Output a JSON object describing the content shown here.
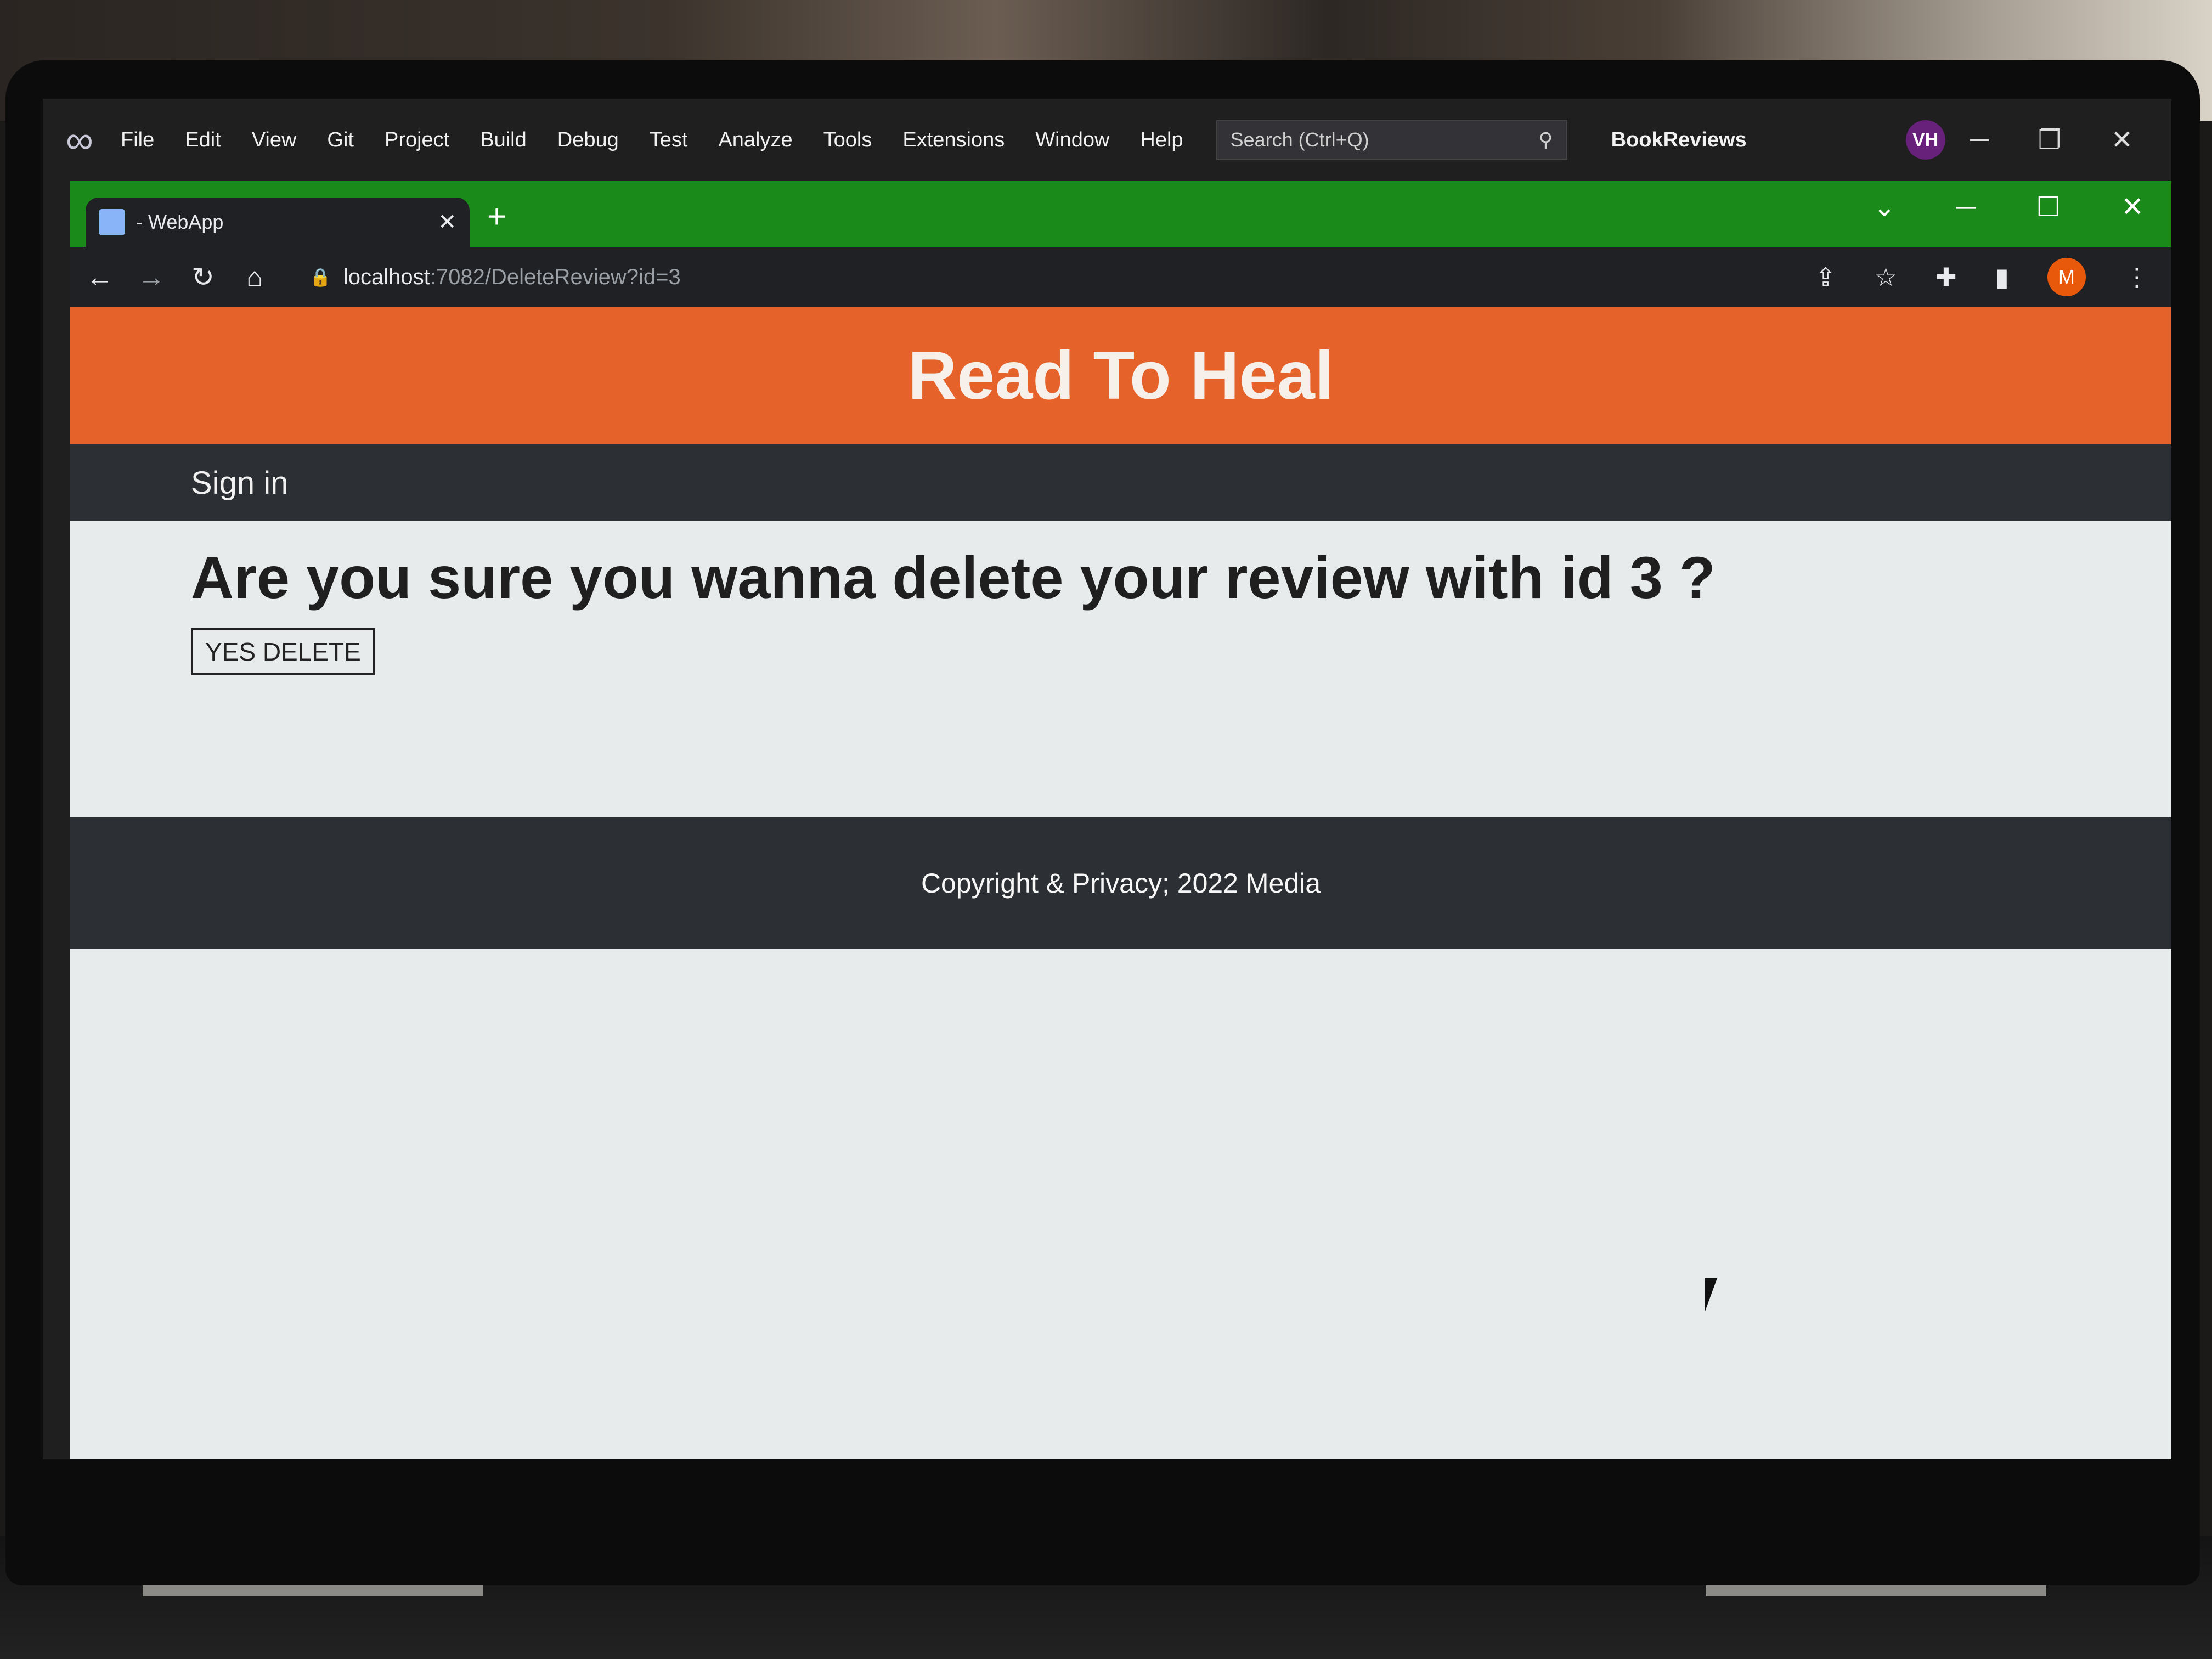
{
  "vs": {
    "menu": [
      "File",
      "Edit",
      "View",
      "Git",
      "Project",
      "Build",
      "Debug",
      "Test",
      "Analyze",
      "Tools",
      "Extensions",
      "Window",
      "Help"
    ],
    "search_placeholder": "Search (Ctrl+Q)",
    "solution_title": "BookReviews",
    "avatar_initials": "VH"
  },
  "browser": {
    "tab_title": "- WebApp",
    "url_host": "localhost",
    "url_path": ":7082/DeleteReview?id=3",
    "profile_initial": "M",
    "tabstrip_color": "#1a8a1a"
  },
  "page": {
    "site_title": "Read To Heal",
    "nav_signin": "Sign in",
    "question": "Are you sure you wanna delete your review with id 3 ?",
    "delete_button": "YES DELETE",
    "footer": "Copyright & Privacy; 2022 Media",
    "header_color": "#e5622a"
  }
}
